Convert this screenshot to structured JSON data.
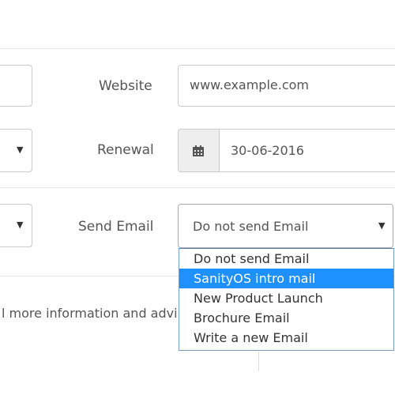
{
  "form": {
    "website": {
      "label": "Website",
      "value": "www.example.com"
    },
    "renewal": {
      "label": "Renewal",
      "value": "30-06-2016",
      "icon": "calendar-icon"
    },
    "send_email": {
      "label": "Send Email",
      "selected": "Do not send Email",
      "options": [
        "Do not send Email",
        "SanityOS intro mail",
        "New Product Launch",
        "Brochure Email",
        "Write a new Email"
      ],
      "highlighted_option": "SanityOS intro mail"
    },
    "info_text": "l more information and advi"
  },
  "colors": {
    "highlight": "#1e90ff",
    "addon_bg": "#eeeeee",
    "border": "#cccccc"
  }
}
